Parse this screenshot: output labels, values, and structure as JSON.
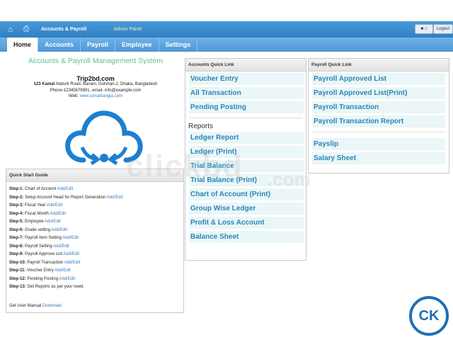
{
  "header": {
    "home_icon": "home-icon",
    "print_icon": "printer-icon",
    "title": "Accounts & Payroll",
    "dots": ". . . . .",
    "panel": "Admin Panel",
    "user_label": "■ □",
    "logout_label": "Logout"
  },
  "nav": {
    "tabs": [
      {
        "label": "Home"
      },
      {
        "label": "Accounts"
      },
      {
        "label": "Payroll"
      },
      {
        "label": "Employee"
      },
      {
        "label": "Settings"
      }
    ]
  },
  "company": {
    "system_title": "Accounts & Payroll Management System",
    "name": "Trip2bd.com",
    "address_bold": "123 Kamal",
    "address_rest": " Ataturk Road, Banani, Gulshan-2, Dhaka, Bangladesh",
    "phone": "Phone-12345678901, email- info@example.com",
    "web_label": "Web: ",
    "web_link": "www.sonarbangla.com"
  },
  "quick_start": {
    "title": "Quick Start Guide",
    "steps": [
      {
        "step": "Step-1:",
        "text": " Chart of Account ",
        "link": "Add/Edit"
      },
      {
        "step": "Step-2:",
        "text": " Setup Account Head for Report Generation ",
        "link": "Add/Edit"
      },
      {
        "step": "Step-3:",
        "text": " Fiscal Year ",
        "link": "Add/Edit"
      },
      {
        "step": "Step-4:",
        "text": " Fiscal Month ",
        "link": "Add/Edit"
      },
      {
        "step": "Step-5:",
        "text": " Employee ",
        "link": "Add/Edit"
      },
      {
        "step": "Step-6:",
        "text": " Grade setting ",
        "link": "Add/Edit"
      },
      {
        "step": "Step-7:",
        "text": " Payroll Item Setting ",
        "link": "Add/Edit"
      },
      {
        "step": "Step-8:",
        "text": " Payroll Setting ",
        "link": "Add/Edit"
      },
      {
        "step": "Step-9:",
        "text": " Payroll Approve List ",
        "link": "Add/Edit"
      },
      {
        "step": "Step-10:",
        "text": " Payroll Transaction ",
        "link": "Add/Edit"
      },
      {
        "step": "Step-11:",
        "text": " Voucher Entry ",
        "link": "Add/Edit"
      },
      {
        "step": "Step-12:",
        "text": " Pending Posting ",
        "link": "Add/Edit"
      },
      {
        "step": "Step-13:",
        "text": " Get Reports as per your need.",
        "link": ""
      }
    ],
    "manual_text": "Get User Manual ",
    "manual_link": "Download"
  },
  "accounts_quick_link": {
    "title": "Accounts Quick Link",
    "items": [
      "Voucher Entry",
      "All Transaction",
      "Pending Posting"
    ],
    "reports_title": "Reports",
    "reports": [
      "Ledger Report",
      "Ledger (Print)",
      "Trial Balance",
      "Trial Balance (Print)",
      "Chart of Account (Print)",
      "Group Wise Ledger",
      "Profit & Loss Account",
      "Balance Sheet"
    ]
  },
  "payroll_quick_link": {
    "title": "Payroll Quick Link",
    "items": [
      "Payroll Approved List",
      "Payroll Approved List(Print)",
      "Payroll Transaction",
      "Payroll Transaction Report"
    ],
    "items2": [
      "Payslip",
      "Salary Sheet"
    ]
  },
  "watermark": {
    "main": "clickbd",
    "suffix": ".com"
  },
  "badge": {
    "text": "CK"
  },
  "colors": {
    "header": "#2f7fc4",
    "nav": "#4f98d6",
    "link": "#2a86b8",
    "title_green": "#5bbf8a",
    "logo_blue": "#1e7fd0"
  }
}
